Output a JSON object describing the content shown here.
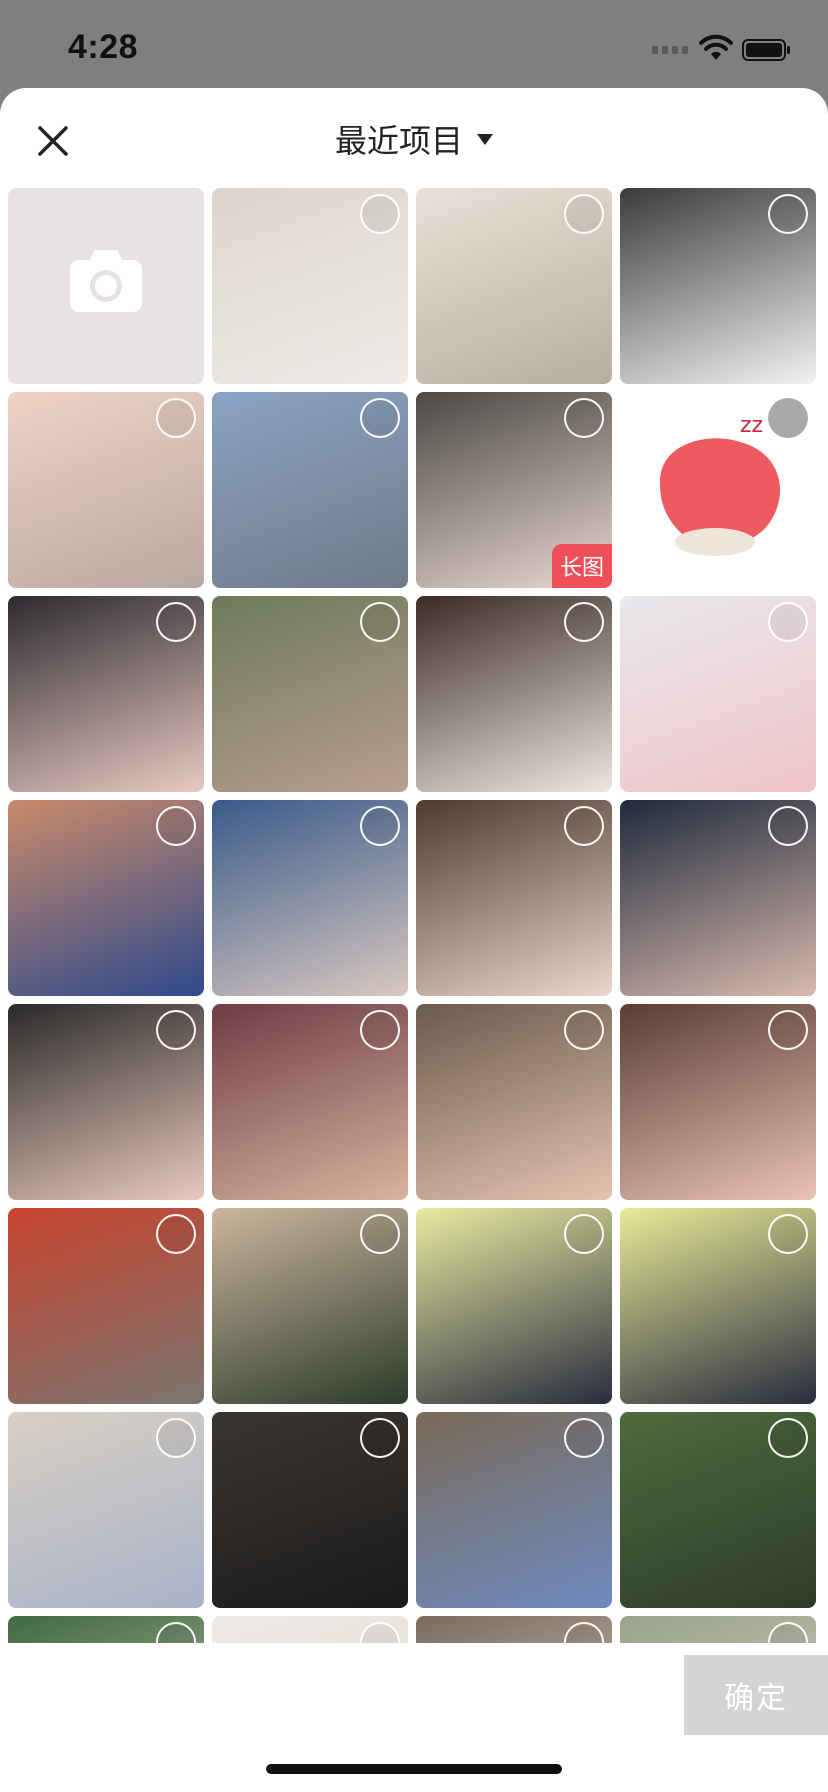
{
  "status_bar": {
    "time": "4:28",
    "icons": [
      "cellular-signal-icon",
      "wifi-icon",
      "battery-icon"
    ]
  },
  "header": {
    "close_icon": "close-icon",
    "title": "最近项目",
    "dropdown_icon": "caret-down-icon"
  },
  "grid": {
    "camera_tile_icon": "camera-icon",
    "long_image_badge": "长图",
    "tiles": [
      {
        "colors": [
          "#dcd4cf",
          "#f0ebe6"
        ]
      },
      {
        "colors": [
          "#e9e1d8",
          "#b8ae9f"
        ]
      },
      {
        "colors": [
          "#3b3b3b",
          "#f2f2f2"
        ]
      },
      {
        "colors": [
          "#efd3c4",
          "#b8a8a0"
        ]
      },
      {
        "colors": [
          "#8aa3c4",
          "#707a88"
        ]
      },
      {
        "colors": [
          "#4b4844",
          "#e8d8cf"
        ]
      },
      {
        "colors": [
          "#ffffff",
          "#ffffff"
        ]
      },
      {
        "colors": [
          "#2d2b30",
          "#e8c9c2"
        ]
      },
      {
        "colors": [
          "#6d7a5a",
          "#b89e8e"
        ]
      },
      {
        "colors": [
          "#3b2b26",
          "#ede7de"
        ]
      },
      {
        "colors": [
          "#e8e8ec",
          "#f0c4c8"
        ]
      },
      {
        "colors": [
          "#c98a6a",
          "#2f4a8c"
        ]
      },
      {
        "colors": [
          "#3a5a8a",
          "#d8c8c0"
        ]
      },
      {
        "colors": [
          "#4e3b30",
          "#e9d6cc"
        ]
      },
      {
        "colors": [
          "#1f2a3b",
          "#d8b9ae"
        ]
      },
      {
        "colors": [
          "#2a2a2a",
          "#e9c9bc"
        ]
      },
      {
        "colors": [
          "#6e3c45",
          "#d8b49e"
        ]
      },
      {
        "colors": [
          "#6a5b4b",
          "#e6c2b0"
        ]
      },
      {
        "colors": [
          "#5b3c32",
          "#e9c3b5"
        ]
      },
      {
        "colors": [
          "#c8432e",
          "#7b7670"
        ]
      },
      {
        "colors": [
          "#cbb69d",
          "#2c3b2b"
        ]
      },
      {
        "colors": [
          "#e8eaa0",
          "#2a2d3e"
        ]
      },
      {
        "colors": [
          "#e8ea96",
          "#2a2d3e"
        ]
      },
      {
        "colors": [
          "#d8cfc4",
          "#a9b3c8"
        ]
      },
      {
        "colors": [
          "#3b3530",
          "#1b1b1b"
        ]
      },
      {
        "colors": [
          "#7a6a58",
          "#6e8bc0"
        ]
      },
      {
        "colors": [
          "#4d6b3c",
          "#2f3b2a"
        ]
      },
      {
        "colors": [
          "#3f6a3e",
          "#cfc6bd"
        ]
      },
      {
        "colors": [
          "#f0ebe6",
          "#ddd6cf"
        ]
      },
      {
        "colors": [
          "#7b6a5e",
          "#e2d8cd"
        ]
      },
      {
        "colors": [
          "#9aa38a",
          "#d8d2c8"
        ]
      }
    ]
  },
  "footer": {
    "confirm_label": "确定"
  },
  "colors": {
    "sheet_bg": "#ffffff",
    "backdrop": "#7f7f7f",
    "badge_red": "#ee4f58",
    "confirm_disabled": "#d4d4d4"
  }
}
